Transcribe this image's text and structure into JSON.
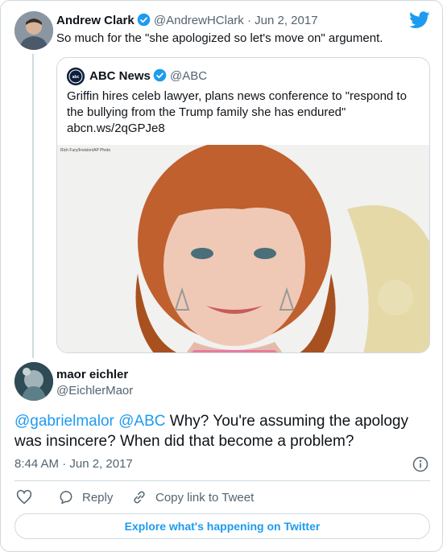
{
  "colors": {
    "accent": "#1d9bf0",
    "text": "#0f1419",
    "secondary": "#536471",
    "border": "#cfd9de"
  },
  "original_tweet": {
    "author_name": "Andrew Clark",
    "handle": "@AndrewHClark",
    "separator": "·",
    "date": "Jun 2, 2017",
    "text": "So much for the \"she apologized so let's move on\" argument.",
    "verified_icon": "verified-badge-icon"
  },
  "quoted_tweet": {
    "author_name": "ABC News",
    "handle": "@ABC",
    "text": "Griffin hires celeb lawyer, plans news conference to \"respond to the bullying from the Trump family she has endured\" abcn.ws/2qGPJe8",
    "photo_credit": "Rich Fury/Invision/AP Photo"
  },
  "reply_tweet": {
    "author_name": "maor eichler",
    "handle": "@EichlerMaor",
    "mention_1": "@gabrielmalor",
    "mention_2": "@ABC",
    "text": " Why? You're assuming the apology was insincere? When did that become a problem?",
    "timestamp": "8:44 AM · Jun 2, 2017"
  },
  "actions": {
    "like_icon": "heart-icon",
    "reply_label": "Reply",
    "copy_label": "Copy link to Tweet"
  },
  "footer": {
    "explore_label": "Explore what's happening on Twitter"
  },
  "icons": [
    "twitter-bird-icon",
    "info-icon",
    "heart-icon",
    "reply-bubble-icon",
    "link-icon"
  ]
}
